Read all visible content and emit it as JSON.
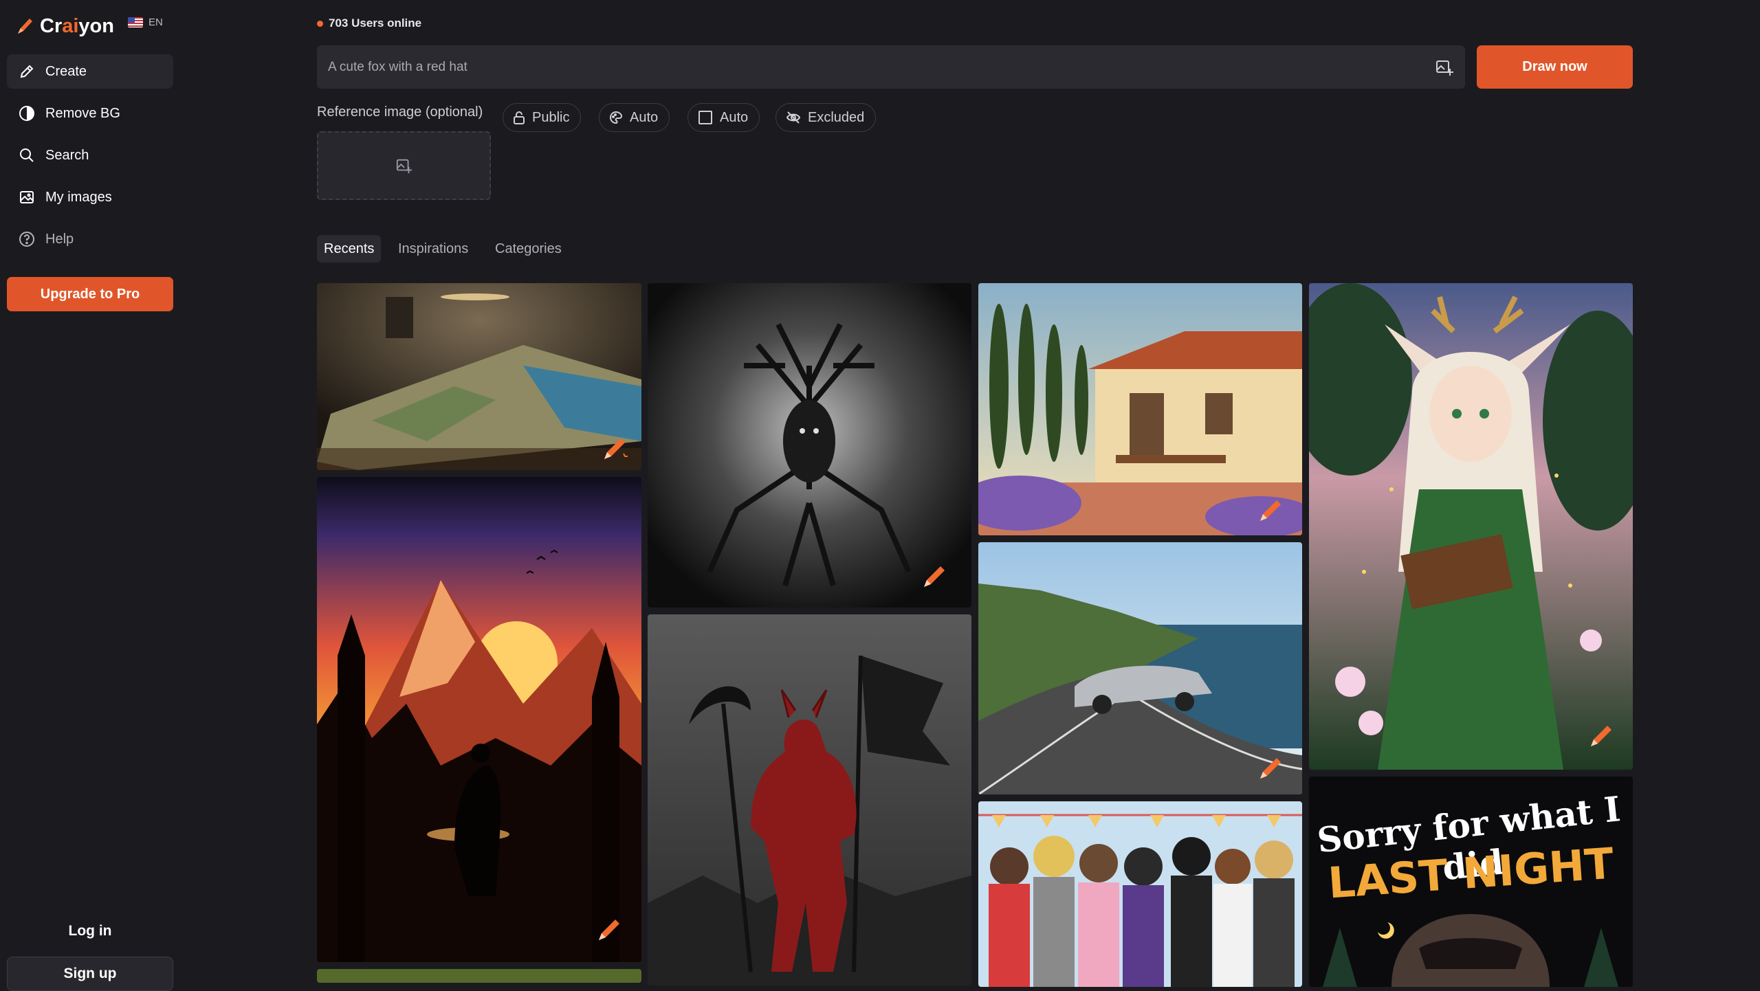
{
  "brand": {
    "name_prefix": "Cr",
    "name_accent": "ai",
    "name_suffix": "yon",
    "lang": "EN",
    "accent": "#e0562a"
  },
  "sidebar": {
    "items": [
      {
        "label": "Create",
        "icon": "pencil-icon"
      },
      {
        "label": "Remove BG",
        "icon": "half-circle-icon"
      },
      {
        "label": "Search",
        "icon": "search-icon"
      },
      {
        "label": "My images",
        "icon": "image-icon"
      },
      {
        "label": "Help",
        "icon": "help-icon"
      }
    ],
    "upgrade_label": "Upgrade to Pro",
    "login_label": "Log in",
    "signup_label": "Sign up"
  },
  "status": {
    "online_text": "703 Users online"
  },
  "prompt": {
    "placeholder": "A cute fox with a red hat",
    "draw_label": "Draw now"
  },
  "options": {
    "reference_label": "Reference image (optional)",
    "visibility": "Public",
    "style": "Auto",
    "ratio": "Auto",
    "negative": "Excluded"
  },
  "tabs": [
    "Recents",
    "Inspirations",
    "Categories"
  ],
  "gallery": {
    "raccoon_text_line1": "Sorry for what I did",
    "raccoon_text_line2": "LAST NIGHT"
  }
}
